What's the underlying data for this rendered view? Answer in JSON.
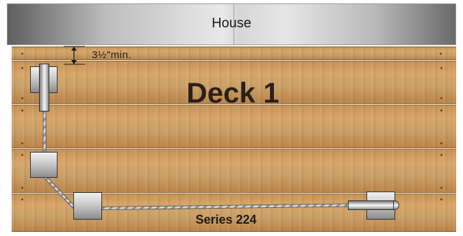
{
  "house": {
    "label": "House"
  },
  "deck": {
    "title": "Deck 1"
  },
  "clearance": {
    "label": "3½″min."
  },
  "product": {
    "series_label": "Series 224"
  },
  "colors": {
    "cable": "#d9d9d9",
    "cable_outline": "#555555",
    "arrow": "#1a1a1a"
  },
  "icons": {
    "dimension_arrow": "double-headed-vertical-arrow",
    "cable_terminal": "threaded-rod-terminal",
    "mounting_block": "mounting-block"
  }
}
